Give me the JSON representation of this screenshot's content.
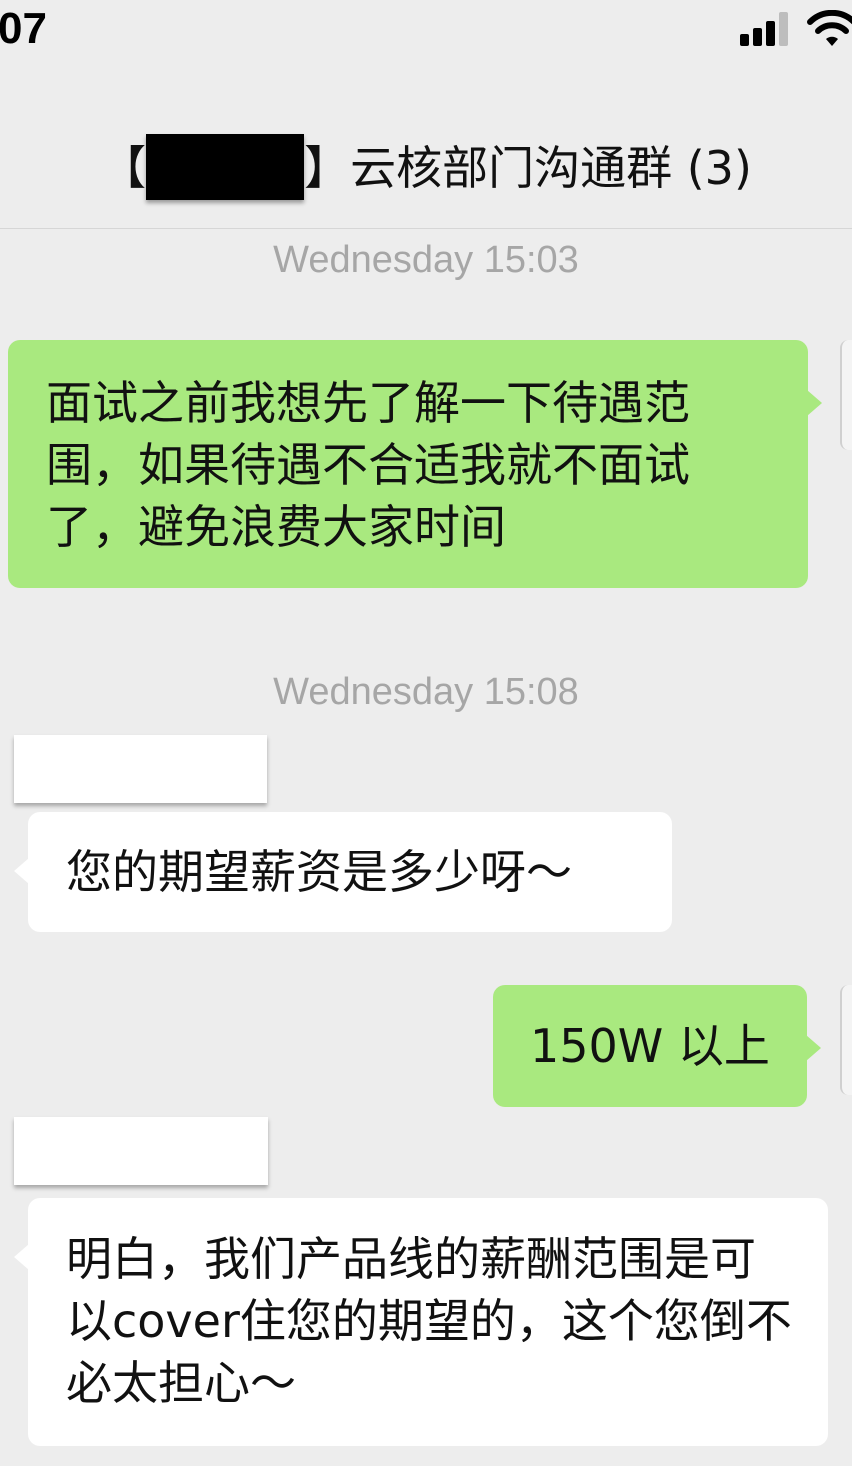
{
  "status_bar": {
    "time": "07"
  },
  "chat": {
    "title_open_bracket": "【",
    "title_rest": "】云核部门沟通群 (3)"
  },
  "messages": {
    "ts1": "Wednesday 15:03",
    "m1": "面试之前我想先了解一下待遇范围，如果待遇不合适我就不面试了，避免浪费大家时间",
    "ts2": "Wednesday 15:08",
    "m2": "您的期望薪资是多少呀～",
    "m3": "150W 以上",
    "m4": "明白，我们产品线的薪酬范围是可以cover住您的期望的，这个您倒不必太担心～"
  },
  "colors": {
    "background": "#ededed",
    "outgoing_bubble": "#a9e97f",
    "incoming_bubble": "#ffffff",
    "timestamp_text": "#a6a6a6"
  },
  "icons": [
    "signal-icon",
    "wifi-icon"
  ]
}
